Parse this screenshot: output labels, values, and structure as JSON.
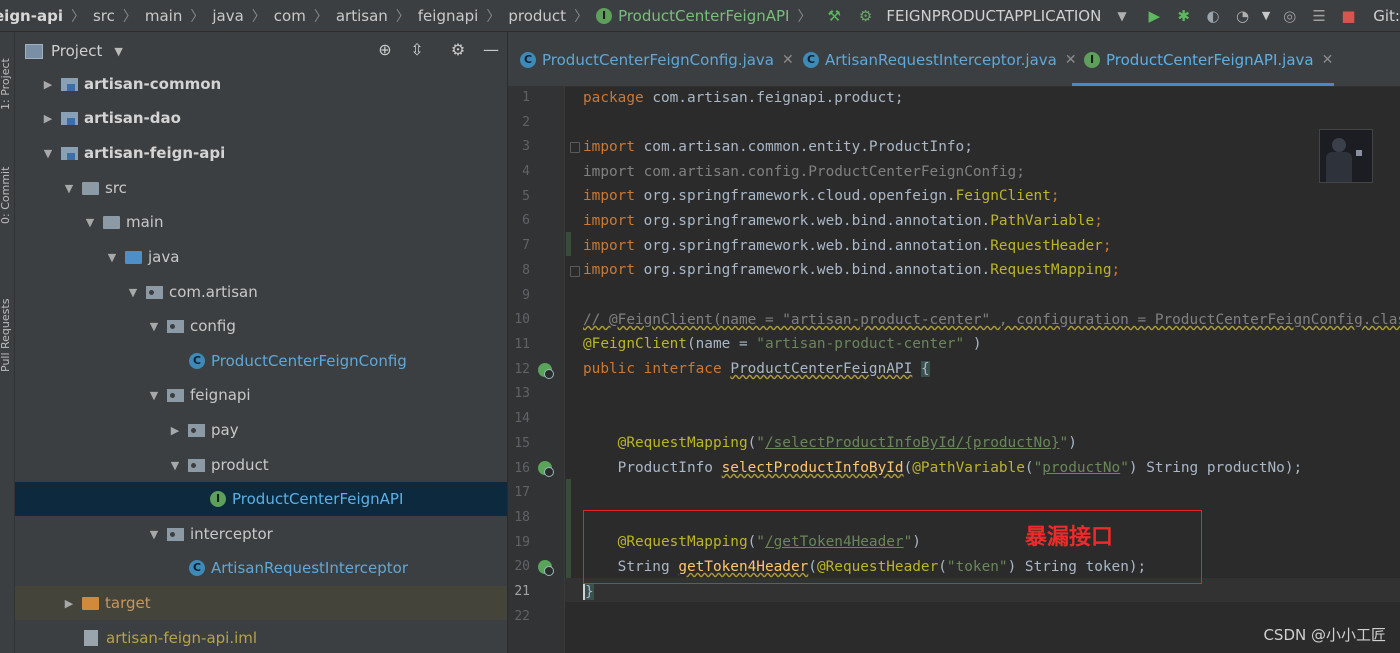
{
  "breadcrumb": {
    "items": [
      "eign-api",
      "src",
      "main",
      "java",
      "com",
      "artisan",
      "feignapi",
      "product",
      "ProductCenterFeignAPI"
    ],
    "interface_icon_letter": "I"
  },
  "run_config": {
    "name": "FEIGNPRODUCTAPPLICATION"
  },
  "toolbar": {
    "git_label": "Git:"
  },
  "left_strip": {
    "project_tab": "1: Project",
    "commit_tab": "0: Commit",
    "pull_requests_tab": "Pull Requests"
  },
  "project_panel": {
    "title": "Project",
    "tree": [
      {
        "label": "artisan-common",
        "icon": "module-icon",
        "arrow": "collapsed"
      },
      {
        "label": "artisan-dao",
        "icon": "module-icon",
        "arrow": "collapsed"
      },
      {
        "label": "artisan-feign-api",
        "icon": "module-icon",
        "arrow": "expanded"
      },
      {
        "label": "src",
        "icon": "folder-icon",
        "arrow": "expanded"
      },
      {
        "label": "main",
        "icon": "folder-icon",
        "arrow": "expanded"
      },
      {
        "label": "java",
        "icon": "source-folder-icon",
        "arrow": "expanded"
      },
      {
        "label": "com.artisan",
        "icon": "package-icon",
        "arrow": "expanded"
      },
      {
        "label": "config",
        "icon": "package-icon",
        "arrow": "expanded"
      },
      {
        "label": "ProductCenterFeignConfig",
        "icon": "class-icon",
        "arrow": "none"
      },
      {
        "label": "feignapi",
        "icon": "package-icon",
        "arrow": "expanded"
      },
      {
        "label": "pay",
        "icon": "package-icon",
        "arrow": "collapsed"
      },
      {
        "label": "product",
        "icon": "package-icon",
        "arrow": "expanded"
      },
      {
        "label": "ProductCenterFeignAPI",
        "icon": "interface-icon",
        "arrow": "none"
      },
      {
        "label": "interceptor",
        "icon": "package-icon",
        "arrow": "expanded"
      },
      {
        "label": "ArtisanRequestInterceptor",
        "icon": "class-icon",
        "arrow": "none"
      },
      {
        "label": "target",
        "icon": "excluded-folder-icon",
        "arrow": "collapsed"
      },
      {
        "label": "artisan-feign-api.iml",
        "icon": "iml-file-icon",
        "arrow": "none"
      }
    ]
  },
  "editor": {
    "tabs": [
      {
        "label": "ProductCenterFeignConfig.java",
        "icon_letter": "C"
      },
      {
        "label": "ArtisanRequestInterceptor.java",
        "icon_letter": "C"
      },
      {
        "label": "ProductCenterFeignAPI.java",
        "icon_letter": "I"
      }
    ],
    "line_numbers": [
      "1",
      "2",
      "3",
      "4",
      "5",
      "6",
      "7",
      "8",
      "9",
      "10",
      "11",
      "12",
      "13",
      "14",
      "15",
      "16",
      "17",
      "18",
      "19",
      "20",
      "21",
      "22"
    ],
    "current_line": "21",
    "code_tokens": {
      "l1_kw": "package",
      "l1_rest": " com.artisan.feignapi.product;",
      "import_kw": "import",
      "l3_rest": " com.artisan.common.entity.ProductInfo;",
      "l4_rest": " com.artisan.config.ProductCenterFeignConfig;",
      "l5_pre": " org.springframework.cloud.openfeign.",
      "l5_cls": "FeignClient",
      "l6_pre": " org.springframework.web.bind.annotation.",
      "l6_cls": "PathVariable",
      "l7_pre": " org.springframework.web.bind.annotation.",
      "l7_cls": "RequestHeader",
      "l8_pre": " org.springframework.web.bind.annotation.",
      "l8_cls": "RequestMapping",
      "semi": ";",
      "l10_comment": "// @FeignClient(name = \"artisan-product-center\" , configuration = ProductCenterFeignConfig.class)",
      "l11_ann": "@FeignClient",
      "l11_a": "(name = ",
      "l11_str": "\"artisan-product-center\"",
      "l11_b": " )",
      "l12_kw1": "public",
      "l12_kw2": "interface",
      "l12_name": "ProductCenterFeignAPI",
      "l12_brace": "{",
      "l15_ann": "@RequestMapping",
      "l15_a": "(",
      "l15_str_q1": "\"",
      "l15_str": "/selectProductInfoById/{productNo}",
      "l15_str_q2": "\"",
      "l15_b": ")",
      "l16_type": "ProductInfo ",
      "l16_method": "selectProductInfoById",
      "l16_a": "(",
      "l16_ann": "@PathVariable",
      "l16_b": "(",
      "l16_q1": "\"",
      "l16_str": "productNo",
      "l16_q2": "\"",
      "l16_c": ") String productNo);",
      "l19_ann": "@RequestMapping",
      "l19_a": "(",
      "l19_q1": "\"",
      "l19_str": "/getToken4Header",
      "l19_q2": "\"",
      "l19_b": ")",
      "l20_type": "String ",
      "l20_method": "getToken4Header",
      "l20_a": "(",
      "l20_ann": "@RequestHeader",
      "l20_b": "(",
      "l20_str": "\"token\"",
      "l20_c": ") String token);",
      "l21_brace": "}"
    }
  },
  "annotation": {
    "label": "暴漏接口",
    "color": "#e0242a"
  },
  "watermark": "CSDN @小小工匠"
}
